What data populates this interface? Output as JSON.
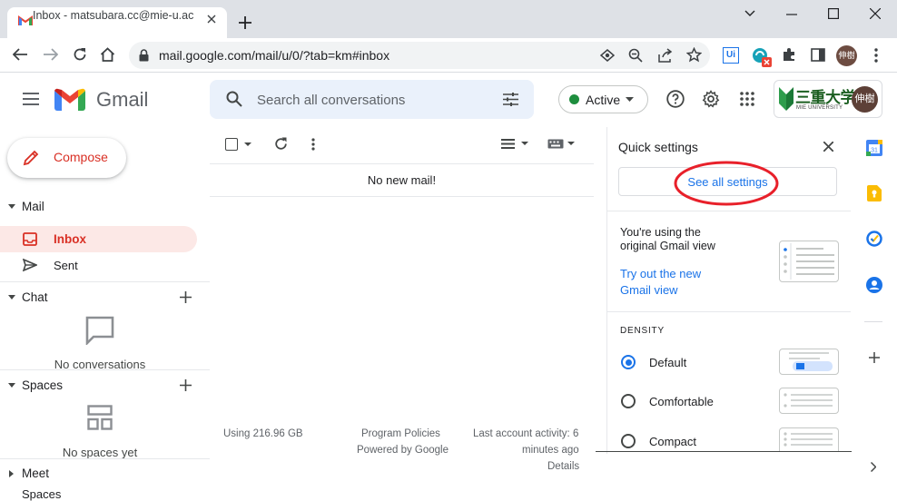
{
  "browser": {
    "tab_title": "Inbox - matsubara.cc@mie-u.ac.jp",
    "url": "mail.google.com/mail/u/0/?tab=km#inbox",
    "profile_label": "伸樹"
  },
  "gmail": {
    "brand": "Gmail",
    "search_placeholder": "Search all conversations",
    "status": "Active",
    "org_logo_text": "三重大学",
    "org_logo_sub": "MIE UNIVERSITY",
    "avatar_label": "伸樹"
  },
  "sidebar": {
    "compose": "Compose",
    "mail_section": "Mail",
    "inbox": "Inbox",
    "sent": "Sent",
    "chat_section": "Chat",
    "chat_empty": "No conversations",
    "spaces_section": "Spaces",
    "spaces_empty": "No spaces yet",
    "meet_section": "Meet",
    "cut_section": "Spaces"
  },
  "main": {
    "empty_message": "No new mail!",
    "storage": "Using 216.96 GB",
    "program_policies": "Program Policies",
    "powered_by": "Powered by Google",
    "last_activity_line1": "Last account activity: 6",
    "last_activity_line2": "minutes ago",
    "details": "Details"
  },
  "quick_settings": {
    "title": "Quick settings",
    "see_all": "See all settings",
    "view_line1": "You're using the",
    "view_line2": "original Gmail view",
    "try_line1": "Try out the new",
    "try_line2": "Gmail view",
    "density_heading": "DENSITY",
    "density_options": [
      "Default",
      "Comfortable",
      "Compact"
    ],
    "density_selected": "Default"
  },
  "colors": {
    "accent_blue": "#1a73e8",
    "gmail_red": "#d93025",
    "active_green": "#1e8e3e",
    "annotation_red": "#e8202a"
  },
  "icons": [
    "menu-icon",
    "search-icon",
    "tune-icon",
    "help-icon",
    "settings-gear-icon",
    "apps-grid-icon",
    "compose-pencil-icon",
    "inbox-icon",
    "sent-icon",
    "chat-bubble-icon",
    "spaces-grid-icon",
    "checkbox-icon",
    "refresh-icon",
    "more-vert-icon",
    "close-icon",
    "calendar-icon",
    "keep-icon",
    "tasks-icon",
    "contacts-icon",
    "add-icon"
  ]
}
